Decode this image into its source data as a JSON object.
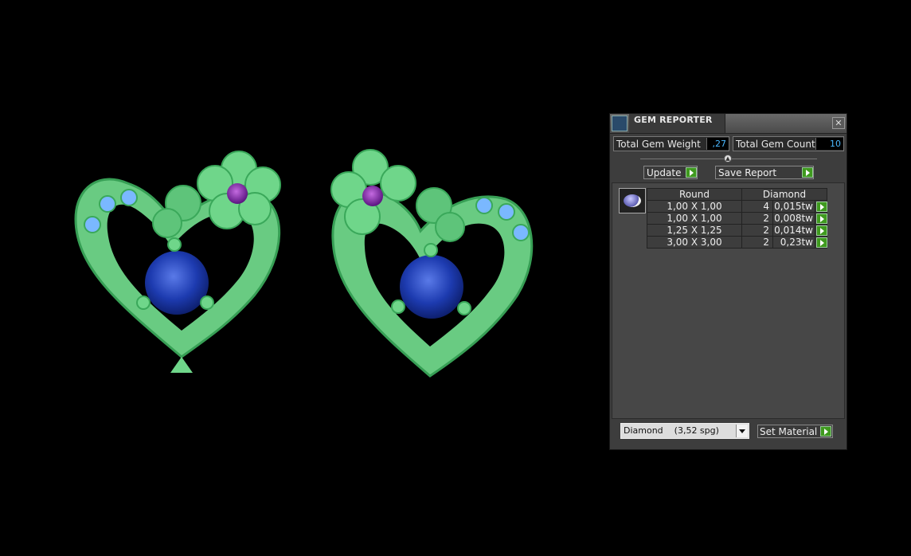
{
  "panel": {
    "title": "GEM REPORTER",
    "close_glyph": "✕",
    "total_weight_label": "Total Gem Weight",
    "total_weight_value": ",27",
    "total_count_label": "Total Gem Count",
    "total_count_value": "10",
    "update_label": "Update",
    "save_report_label": "Save Report",
    "table_header": {
      "shape": "Round",
      "material": "Diamond"
    },
    "rows": [
      {
        "size": "1,00 X 1,00",
        "count": "4",
        "weight": "0,015tw"
      },
      {
        "size": "1,00 X 1,00",
        "count": "2",
        "weight": "0,008tw"
      },
      {
        "size": "1,25 X 1,25",
        "count": "2",
        "weight": "0,014tw"
      },
      {
        "size": "3,00 X 3,00",
        "count": "2",
        "weight": "0,23tw"
      }
    ],
    "material_select": "Diamond    (3,52 spg)",
    "set_material_label": "Set Material"
  },
  "colors": {
    "metal": "#6fd68a",
    "sapphire": "#1a3aa8",
    "amethyst": "#8a2ab0",
    "aquamarine": "#7ab8ff",
    "accent_button": "#3f9a1e",
    "value_text": "#4ab8ff"
  },
  "icons": [
    "gem-reporter-icon",
    "close-icon",
    "slider-knob-icon",
    "arrow-right-icon",
    "dropdown-arrow-icon",
    "gem-thumbnail-icon"
  ]
}
